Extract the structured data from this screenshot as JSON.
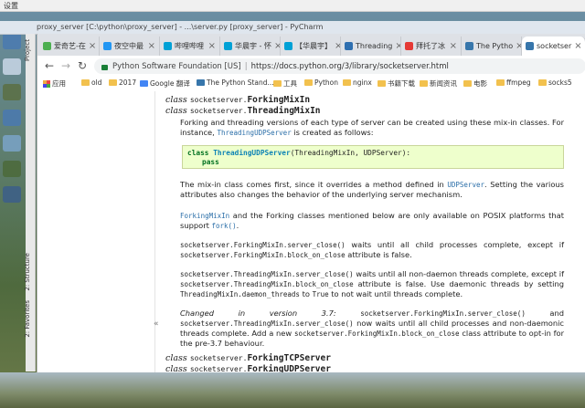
{
  "desktop": {
    "title": "设置"
  },
  "pycharm": {
    "title": "proxy_server [C:\\python\\proxy_server] - ...\\server.py [proxy_server] - PyCharm",
    "side": [
      "Project",
      "2: Structure",
      "2: Favorites"
    ]
  },
  "tabs": [
    {
      "label": "爱奇艺-在",
      "color": "#4caf50"
    },
    {
      "label": "夜空中最",
      "color": "#2196f3"
    },
    {
      "label": "哔哩哔哩",
      "color": "#00a1d6"
    },
    {
      "label": "华晨宇 - 怀",
      "color": "#00a1d6"
    },
    {
      "label": "【华晨宇】",
      "color": "#00a1d6"
    },
    {
      "label": "Threading",
      "color": "#2e6fb0"
    },
    {
      "label": "拜托了冰",
      "color": "#e53935"
    },
    {
      "label": "The Pytho",
      "color": "#3776ab"
    },
    {
      "label": "socketser",
      "color": "#3776ab"
    }
  ],
  "toolbar": {
    "site": "Python Software Foundation [US]",
    "url": "https://docs.python.org/3/library/socketserver.html"
  },
  "bookmarks": [
    {
      "label": "应用",
      "icon": "apps"
    },
    {
      "label": "old",
      "icon": "folder"
    },
    {
      "label": "2017",
      "icon": "folder"
    },
    {
      "label": "Google 翻译",
      "icon": "google"
    },
    {
      "label": "The Python Stand...",
      "icon": "python"
    },
    {
      "label": "工具",
      "icon": "folder"
    },
    {
      "label": "Python",
      "icon": "folder"
    },
    {
      "label": "nginx",
      "icon": "folder"
    },
    {
      "label": "书籍下载",
      "icon": "folder"
    },
    {
      "label": "新闻资讯",
      "icon": "folder"
    },
    {
      "label": "电影",
      "icon": "folder"
    },
    {
      "label": "ffmpeg",
      "icon": "folder"
    },
    {
      "label": "socks5",
      "icon": "folder"
    }
  ],
  "doc": {
    "c1": {
      "kw": "class",
      "mod": "socketserver.",
      "name": "ForkingMixIn"
    },
    "c2": {
      "kw": "class",
      "mod": "socketserver.",
      "name": "ThreadingMixIn"
    },
    "desc1a": "Forking and threading versions of each type of server can be created using these mix-in classes. For instance,",
    "desc1_link": "ThreadingUDPServer",
    "desc1b": "is created as follows:",
    "code_kw": "class",
    "code_cls": "ThreadingUDPServer",
    "code_rest": "(ThreadingMixIn, UDPServer):",
    "code_pass": "pass",
    "p2a": "The mix-in class comes first, since it overrides a method defined in",
    "p2_link": "UDPServer",
    "p2b": ". Setting the various attributes also changes the behavior of the underlying server mechanism.",
    "p3_link1": "ForkingMixIn",
    "p3a": "and the Forking classes mentioned below are only available on POSIX platforms that support",
    "p3_link2": "fork()",
    "p3b": ".",
    "p4_code1": "socketserver.ForkingMixIn.server_close()",
    "p4a": "waits until all child processes complete, except if",
    "p4_code2": "socketserver.ForkingMixIn.block_on_close",
    "p4b": "attribute is false.",
    "p5_code1": "socketserver.ThreadingMixIn.server_close()",
    "p5a": "waits until all non-daemon threads complete, except if",
    "p5_code2": "socketserver.ThreadingMixIn.block_on_close",
    "p5b": "attribute is false. Use daemonic threads by setting",
    "p5_code3": "ThreadingMixIn.daemon_threads",
    "p5c": "to",
    "p5_code4": "True",
    "p5d": "to not wait until threads complete.",
    "p6_em": "Changed in version 3.7:",
    "p6_code1": "socketserver.ForkingMixIn.server_close()",
    "p6a": "and",
    "p6_code2": "socketserver.ThreadingMixIn.server_close()",
    "p6b": "now waits until all child processes and non-daemonic threads complete. Add a new",
    "p6_code3": "socketserver.ForkingMixIn.block_on_close",
    "p6c": "class attribute to opt-in for the pre-3.7 behaviour.",
    "c3": {
      "kw": "class",
      "mod": "socketserver.",
      "name": "ForkingTCPServer"
    },
    "c4": {
      "kw": "class",
      "mod": "socketserver.",
      "name": "ForkingUDPServer"
    }
  }
}
